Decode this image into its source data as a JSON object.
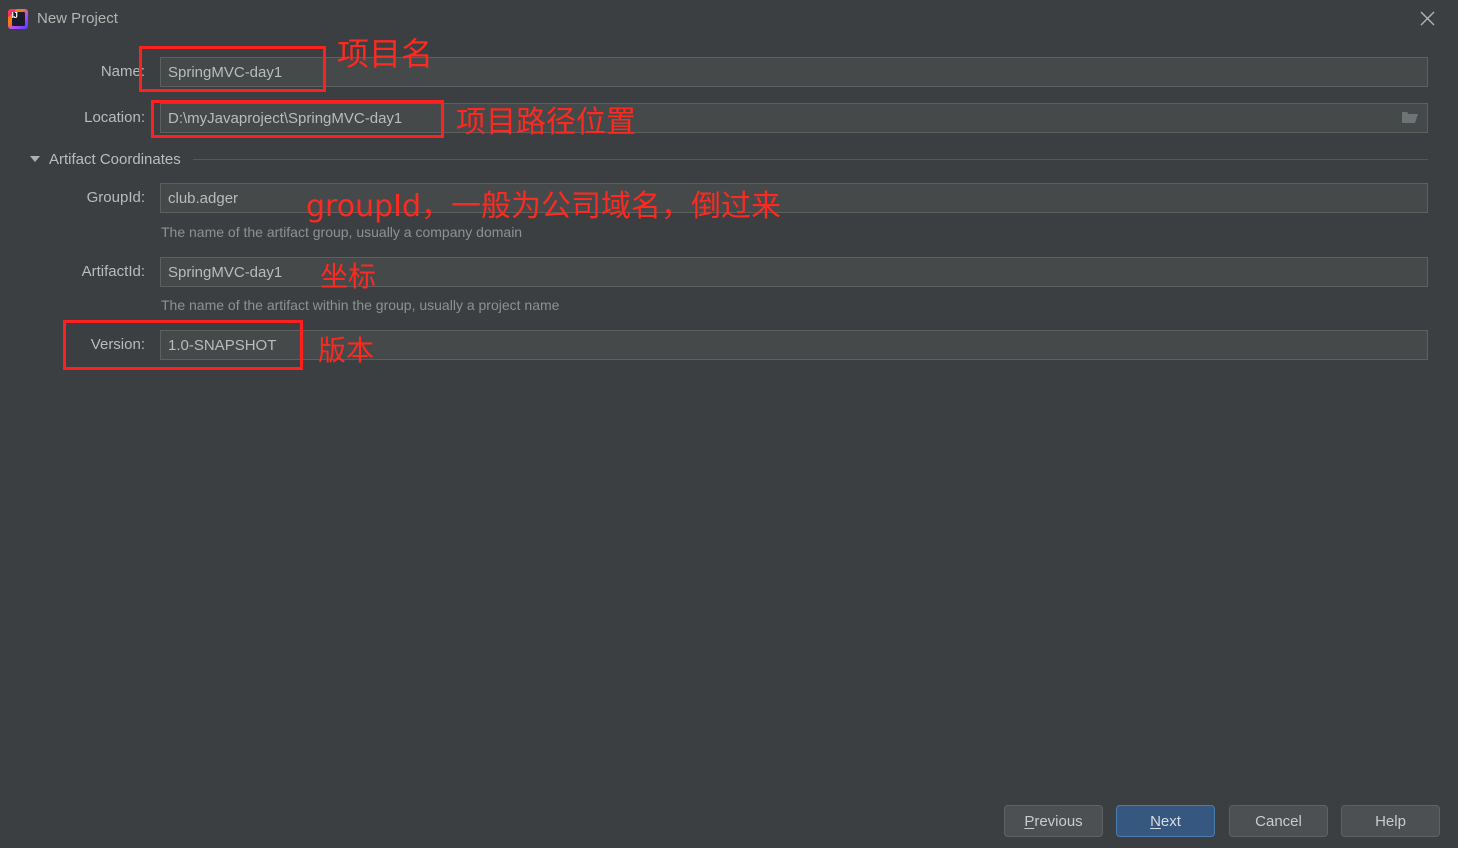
{
  "window": {
    "title": "New Project",
    "app_icon": "intellij-idea-logo",
    "ij_mark": "IJ",
    "close_icon": "close-icon"
  },
  "form": {
    "name": {
      "label": "Name:",
      "value": "SpringMVC-day1"
    },
    "location": {
      "label": "Location:",
      "value": "D:\\myJavaproject\\SpringMVC-day1",
      "browse_icon": "folder-icon"
    },
    "section": {
      "label": "Artifact Coordinates",
      "expander_icon": "chevron-down-icon"
    },
    "group_id": {
      "label": "GroupId:",
      "value": "club.adger",
      "helper": "The name of the artifact group, usually a company domain"
    },
    "artifact_id": {
      "label": "ArtifactId:",
      "value": "SpringMVC-day1",
      "helper": "The name of the artifact within the group, usually a project name"
    },
    "version": {
      "label": "Version:",
      "value": "1.0-SNAPSHOT"
    }
  },
  "annotations": {
    "project_name": "项目名",
    "project_path": "项目路径位置",
    "group_id": "groupId，一般为公司域名，倒过来",
    "coordinates": "坐标",
    "version": "版本",
    "color": "#fc2a20"
  },
  "footer": {
    "previous": {
      "mnemonic": "P",
      "rest": "revious"
    },
    "next": {
      "mnemonic": "N",
      "rest": "ext"
    },
    "cancel": "Cancel",
    "help": "Help"
  },
  "colors": {
    "background": "#3c3f41",
    "field_background": "#45494a",
    "field_border": "#5e6060",
    "primary_button": "#365880",
    "text": "#bbbbbb",
    "helper_text": "#8e9192",
    "annotation_red": "#fc2a20"
  }
}
